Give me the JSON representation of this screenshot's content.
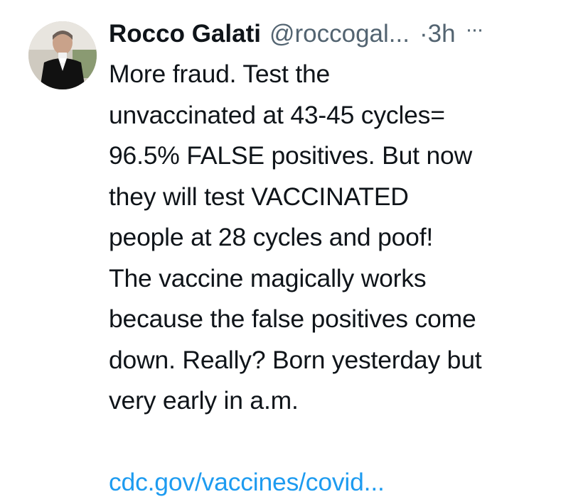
{
  "tweet": {
    "author": {
      "display_name": "Rocco Galati",
      "handle": "@roccogal...",
      "avatar_icon": "profile-photo"
    },
    "time_separator": "·",
    "timestamp": "3h",
    "more_icon": "···",
    "text": "More fraud. Test the\nunvaccinated at 43-45 cycles=\n96.5% FALSE positives. But now\nthey will test VACCINATED\npeople at 28 cycles and poof!\nThe vaccine magically works\nbecause the false positives come\ndown. Really? Born yesterday but\nvery early in a.m.",
    "link": "cdc.gov/vaccines/covid..."
  },
  "colors": {
    "text": "#0f1419",
    "secondary": "#536471",
    "link": "#1d9bf0",
    "background": "#ffffff"
  }
}
